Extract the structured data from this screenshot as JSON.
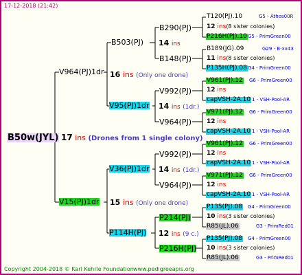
{
  "header": {
    "date": "17-12-2018 (21:42)"
  },
  "footer": {
    "copyright": "Copyright 2004-2018 © Karl Kehrle Foundation",
    "site": "www.pedigreeapis.org"
  },
  "root": {
    "name": "B50w(JYL)",
    "ins_count": "17",
    "ins_unit": "ins",
    "note": "(Drones from 1 single colony)"
  },
  "gen1": [
    {
      "name": "V964(PJ)1dr",
      "ins_count": "16",
      "ins_unit": "ins",
      "note": "(Only one drone)"
    },
    {
      "name": "V15(PJ)1dr",
      "ins_count": "15",
      "ins_unit": "ins",
      "note": "(Only one drone)"
    }
  ],
  "gen2": [
    {
      "name": "B503(PJ)",
      "ins_count": "14",
      "ins_unit": "ins",
      "note": ""
    },
    {
      "name": "V95(PJ)1dr",
      "ins_count": "14",
      "ins_unit": "ins",
      "note": "(1dr.)"
    },
    {
      "name": "V36(PJ)1dr",
      "ins_count": "14",
      "ins_unit": "ins",
      "note": "(1dr.)"
    },
    {
      "name": "P114H(PJ)",
      "ins_count": "12",
      "ins_unit": "ins",
      "note": "(9 c.)"
    }
  ],
  "gen3": [
    {
      "name": "B290(PJ)",
      "ins_count": "",
      "ins_unit": ""
    },
    {
      "name": "B148(PJ)",
      "ins_count": "",
      "ins_unit": ""
    },
    {
      "name": "V992(PJ)",
      "ins_count": "",
      "ins_unit": ""
    },
    {
      "name": "V964(PJ)",
      "ins_count": "",
      "ins_unit": ""
    },
    {
      "name": "V992(PJ)",
      "ins_count": "",
      "ins_unit": ""
    },
    {
      "name": "V964(PJ)",
      "ins_count": "",
      "ins_unit": ""
    },
    {
      "name": "P214(PJ)",
      "ins_count": "12",
      "ins_unit": "ins",
      "note": "(9 c.)"
    },
    {
      "name": "P216H(PJ)",
      "ins_count": "",
      "ins_unit": ""
    }
  ],
  "gen4": [
    {
      "top": "T120(PJ).10",
      "top_extra": "G5 - Athos00R",
      "mid_count": "12",
      "mid_unit": "ins",
      "mid_note": "(8 sister colonies)",
      "bottom": "P216H(PJ).10",
      "bottom_extra": "G5 - PrimGreen00"
    },
    {
      "top": "B189(JG).09",
      "top_extra": "G29 - B-xx43",
      "mid_count": "11",
      "mid_unit": "ins",
      "mid_note": "(8 sister colonies)",
      "bottom": "P135H(PJ).08",
      "bottom_extra": "G4 - PrimGreen00"
    },
    {
      "top": "V961(PJ).12",
      "top_extra": "G6 - PrimGreen00",
      "mid_count": "12",
      "mid_unit": "ins",
      "mid_note": "",
      "bottom": "capVSH-2A.10",
      "bottom_extra": "1 - VSH-Pool-AR"
    },
    {
      "top": "V971(PJ).12",
      "top_extra": "G6 - PrimGreen00",
      "mid_count": "12",
      "mid_unit": "ins",
      "mid_note": "",
      "bottom": "capVSH-2A.10",
      "bottom_extra": "1 - VSH-Pool-AR"
    },
    {
      "top": "V961(PJ).12",
      "top_extra": "G6 - PrimGreen00",
      "mid_count": "12",
      "mid_unit": "ins",
      "mid_note": "",
      "bottom": "capVSH-2A.10",
      "bottom_extra": "1 - VSH-Pool-AR"
    },
    {
      "top": "V971(PJ).12",
      "top_extra": "G6 - PrimGreen00",
      "mid_count": "12",
      "mid_unit": "ins",
      "mid_note": "",
      "bottom": "capVSH-2A.10",
      "bottom_extra": "1 - VSH-Pool-AR"
    },
    {
      "top": "P135(PJ).08",
      "top_extra": "G4 - PrimGreen00",
      "mid_count": "10",
      "mid_unit": "ins",
      "mid_note": "(3 sister colonies)",
      "bottom": "R85(JL).06",
      "bottom_extra": "G3 - PrimRed01"
    },
    {
      "top": "P135(PJ).08",
      "top_extra": "G4 - PrimGreen00",
      "mid_count": "10",
      "mid_unit": "ins",
      "mid_note": "(3 sister colonies)",
      "bottom": "R85(JL).06",
      "bottom_extra": "G3 - PrimRed01"
    }
  ],
  "colors": {
    "cyan": "#14d8ee",
    "green": "#22d422",
    "grey": "#c8c8c8",
    "ins_red": "#e00000",
    "frame": "#b0007a"
  }
}
